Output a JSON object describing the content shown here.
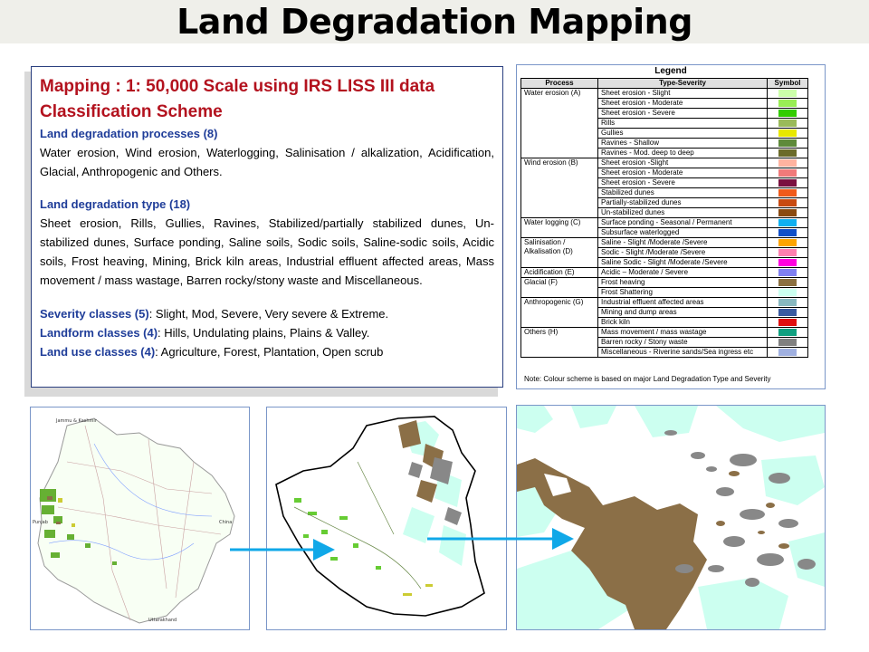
{
  "title": "Land Degradation Mapping",
  "left_panel": {
    "heading1": "Mapping : 1: 50,000 Scale using IRS LISS III data",
    "heading2": "Classification Scheme",
    "processes_label": "Land degradation processes (8)",
    "processes_text": "Water erosion, Wind erosion, Waterlogging, Salinisation / alkalization, Acidification, Glacial, Anthropogenic and Others.",
    "types_label": "Land degradation type (18)",
    "types_text": "Sheet erosion, Rills, Gullies, Ravines, Stabilized/partially stabilized dunes, Un-stabilized dunes, Surface ponding, Saline soils, Sodic soils, Saline-sodic soils, Acidic soils, Frost heaving, Mining, Brick kiln areas, Industrial effluent affected areas, Mass movement / mass wastage, Barren rocky/stony waste and Miscellaneous.",
    "severity_label": "Severity classes (5)",
    "severity_text": ": Slight, Mod, Severe, Very severe & Extreme.",
    "landform_label": "Landform classes (4)",
    "landform_text": ": Hills, Undulating plains, Plains & Valley.",
    "landuse_label": "Land use classes (4)",
    "landuse_text": ":  Agriculture, Forest, Plantation, Open scrub"
  },
  "legend": {
    "title": "Legend",
    "headers": [
      "Process",
      "Type-Severity",
      "Symbol"
    ],
    "groups": [
      {
        "process": "Water erosion (A)",
        "rows": [
          {
            "type": "Sheet erosion - Slight",
            "color": "#ccffaa"
          },
          {
            "type": "Sheet erosion - Moderate",
            "color": "#99ee55"
          },
          {
            "type": "Sheet erosion - Severe",
            "color": "#33cc00"
          },
          {
            "type": "Rills",
            "color": "#9aba5a"
          },
          {
            "type": "Gullies",
            "color": "#e8e800"
          },
          {
            "type": "Ravines - Shallow",
            "color": "#5e8a3a"
          },
          {
            "type": "Ravines - Mod. deep to deep",
            "color": "#6b6b2a"
          }
        ]
      },
      {
        "process": "Wind erosion (B)",
        "rows": [
          {
            "type": "Sheet erosion -Slight",
            "color": "#ffb3a0"
          },
          {
            "type": "Sheet erosion - Moderate",
            "color": "#f07a7a"
          },
          {
            "type": "Sheet erosion - Severe",
            "color": "#7a1040"
          },
          {
            "type": "Stabilized dunes",
            "color": "#f05a1a"
          },
          {
            "type": "Partially-stabilized dunes",
            "color": "#c84a10"
          },
          {
            "type": "Un-stabilized dunes",
            "color": "#8a4a10"
          }
        ]
      },
      {
        "process": "Water logging (C)",
        "rows": [
          {
            "type": "Surface ponding - Seasonal / Permanent",
            "color": "#10b0f0"
          },
          {
            "type": "Subsurface waterlogged",
            "color": "#1050c8"
          }
        ]
      },
      {
        "process": "Salinisation / Alkalisation (D)",
        "rows": [
          {
            "type": "Saline - Slight /Moderate /Severe",
            "color": "#ffa500"
          },
          {
            "type": "Sodic -  Slight /Moderate /Severe",
            "color": "#ff80b0"
          },
          {
            "type": "Saline Sodic - Slight /Moderate /Severe",
            "color": "#ff00e0"
          }
        ]
      },
      {
        "process": "Acidification (E)",
        "rows": [
          {
            "type": "Acidic – Moderate / Severe",
            "color": "#8080f0"
          }
        ]
      },
      {
        "process": "Glacial  (F)",
        "rows": [
          {
            "type": "Frost heaving",
            "color": "#8b7040"
          },
          {
            "type": "Frost Shattering",
            "color": "#ccfff0"
          }
        ]
      },
      {
        "process": "Anthropogenic (G)",
        "rows": [
          {
            "type": "Industrial effluent affected areas",
            "color": "#88b8c0"
          },
          {
            "type": "Mining and dump areas",
            "color": "#3a5aa0"
          },
          {
            "type": "Brick kiln",
            "color": "#e01010"
          }
        ]
      },
      {
        "process": "Others (H)",
        "rows": [
          {
            "type": "Mass movement / mass wastage",
            "color": "#10a080"
          },
          {
            "type": "Barren rocky / Stony waste",
            "color": "#808080"
          },
          {
            "type": "Miscellaneous  - Riverine sands/Sea ingress etc",
            "color": "#a0b0e0"
          }
        ]
      }
    ],
    "note": "Note: Colour scheme is based on major Land Degradation Type and Severity"
  },
  "maps": {
    "state_labels": [
      "Jammu & Kashmir",
      "Punjab",
      "China",
      "Uttarakhand"
    ],
    "colors": {
      "frost_heaving": "#8b6f47",
      "frost_shattering": "#ccfff0",
      "barren_rocky": "#888888",
      "sheet_erosion": "#66cc33",
      "arrow": "#10a8e8"
    }
  }
}
